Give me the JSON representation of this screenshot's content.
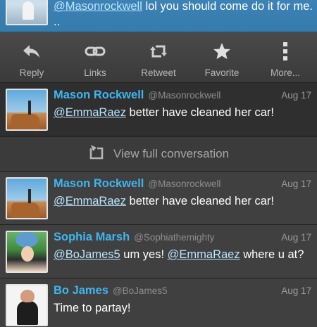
{
  "top_tweet": {
    "mention": "@Masonrockwell",
    "text": " lol you should come do it for me.",
    "overflow": ".."
  },
  "actions": [
    {
      "label": "Reply",
      "icon": "reply-icon"
    },
    {
      "label": "Links",
      "icon": "link-icon"
    },
    {
      "label": "Retweet",
      "icon": "retweet-icon"
    },
    {
      "label": "Favorite",
      "icon": "star-icon"
    },
    {
      "label": "More...",
      "icon": "more-vertical-icon"
    }
  ],
  "focused_tweet": {
    "name": "Mason Rockwell",
    "handle": "@Masonrockwell",
    "time": "Aug 17",
    "mention": "@EmmaRaez",
    "text": " better have cleaned her car!"
  },
  "view_full": {
    "label": "View full conversation",
    "icon": "conversation-icon"
  },
  "conversation": [
    {
      "name": "Mason Rockwell",
      "handle": "@Masonrockwell",
      "time": "Aug 17",
      "mention1": "@EmmaRaez",
      "text1": " better have cleaned her car!",
      "mention2": "",
      "text2": ""
    },
    {
      "name": "Sophia Marsh",
      "handle": "@Sophiathemighty",
      "time": "Aug 17",
      "mention1": "@BoJames5",
      "text1": " um yes! ",
      "mention2": "@EmmaRaez",
      "text2": " where u at?"
    },
    {
      "name": "Bo James",
      "handle": "@BoJames5",
      "time": "Aug 17",
      "mention1": "",
      "text1": "Time to partay!",
      "mention2": "",
      "text2": ""
    }
  ],
  "colors": {
    "accent_blue": "#3fb6f0",
    "top_bar_blue": "#3d82b5",
    "mention_light": "#b9e6ff"
  }
}
